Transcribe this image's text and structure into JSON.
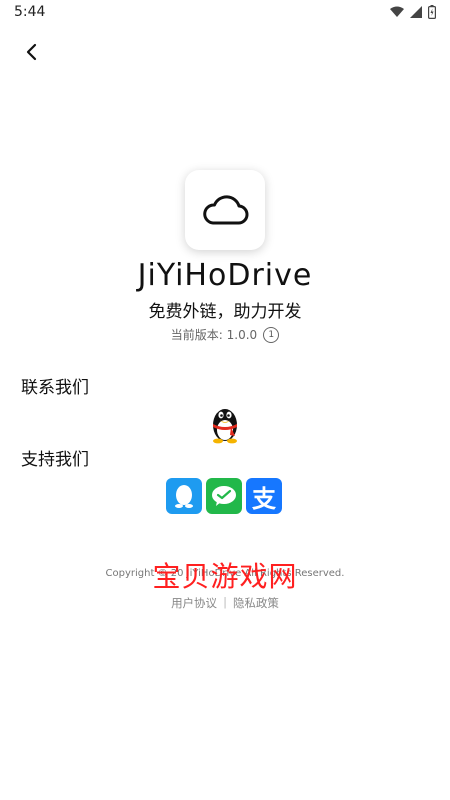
{
  "status_bar": {
    "time": "5:44",
    "icons": [
      "wifi-icon",
      "signal-icon",
      "battery-icon"
    ]
  },
  "nav": {
    "back_icon": "chevron-left-icon"
  },
  "app": {
    "icon": "cloud-icon",
    "name": "JiYiHoDrive",
    "slogan": "免费外链，助力开发",
    "version_label": "当前版本: 1.0.0",
    "version_badge": "1"
  },
  "contact": {
    "title": "联系我们",
    "items": [
      "qq-penguin-icon"
    ]
  },
  "support": {
    "title": "支持我们",
    "items": [
      "qq-pay-icon",
      "wechat-pay-icon",
      "alipay-icon"
    ],
    "alipay_glyph": "支"
  },
  "footer": {
    "copyright": "Copyright © 20   JiYiHoDrive All Rights Reserved.",
    "user_agreement": "用户协议",
    "separator": "|",
    "privacy_policy": "隐私政策"
  },
  "watermark": {
    "text": "宝贝游戏网"
  },
  "colors": {
    "qq_blue": "#1e9bf0",
    "wechat_green": "#22b84a",
    "alipay_blue": "#1677ff",
    "watermark_red": "#ff2020"
  }
}
